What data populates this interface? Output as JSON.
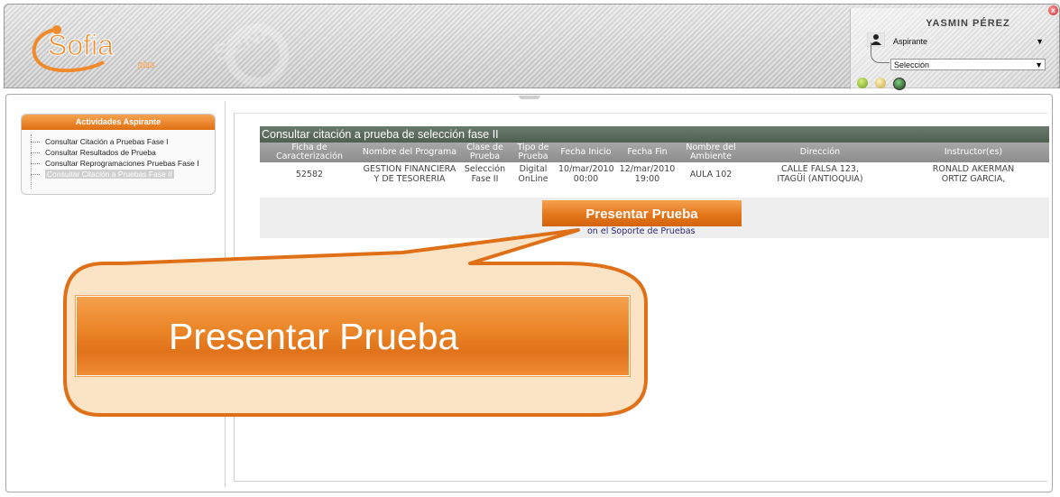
{
  "header": {
    "logo_text": "Sofia",
    "logo_sub": "plus",
    "watermark": "SENA",
    "user_name": "YASMIN PÉREZ",
    "role_value": "Aspirante",
    "selection_value": "Selección",
    "close_label": "x"
  },
  "sidebar": {
    "title": "Actividades Aspirante",
    "items": [
      {
        "label": "Consultar Citación a Pruebas Fase I"
      },
      {
        "label": "Consultar Resultados de Prueba"
      },
      {
        "label": "Consultar Reprogramaciones Pruebas Fase I"
      },
      {
        "label": "Consultar Citación a Pruebas Fase II"
      }
    ],
    "active_index": 3
  },
  "main": {
    "title": "Consultar citación a prueba de selección fase II",
    "columns": [
      "Ficha de Caracterización",
      "Nombre del Programa",
      "Clase de Prueba",
      "Tipo de Prueba",
      "Fecha Inicio",
      "Fecha Fin",
      "Nombre del Ambiente",
      "Dirección",
      "Instructor(es)"
    ],
    "row": {
      "ficha": "52582",
      "programa_1": "GESTION FINANCIERA",
      "programa_2": "Y DE TESORERIA",
      "clase_1": "Selección",
      "clase_2": "Fase II",
      "tipo_1": "Digital",
      "tipo_2": "OnLine",
      "inicio_1": "10/mar/2010",
      "inicio_2": "00:00",
      "fin_1": "12/mar/2010",
      "fin_2": "19:00",
      "ambiente": "AULA 102",
      "direccion_1": "CALLE FALSA 123,",
      "direccion_2": "ITAGÜÍ (ANTIOQUIA)",
      "instructor_1": "RONALD AKERMAN",
      "instructor_2": "ORTIZ GARCIA,"
    },
    "present_button": "Presentar Prueba",
    "support_text": "on el Soporte de Pruebas"
  },
  "callout": {
    "button_label": "Presentar Prueba"
  },
  "colors": {
    "accent_orange": "#e3761b",
    "callout_border": "#e07018",
    "callout_fill": "#fbe3c5",
    "table_title_bg": "#5c6c5e",
    "table_header_bg": "#999999"
  }
}
